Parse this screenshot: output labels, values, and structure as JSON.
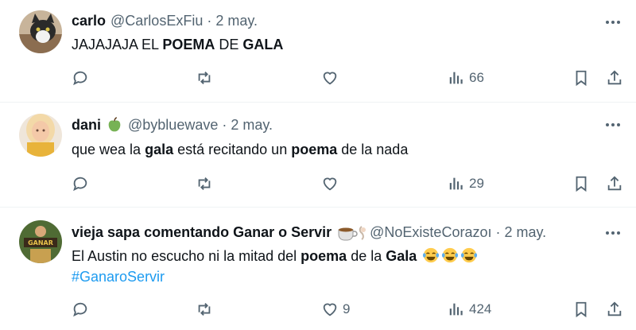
{
  "tweets": [
    {
      "name": "carlo",
      "handle": "@CarlosExFiu",
      "sep": "·",
      "time": "2 may.",
      "body": [
        {
          "t": "JAJAJAJA EL ",
          "b": false
        },
        {
          "t": "POEMA",
          "b": true
        },
        {
          "t": " DE ",
          "b": false
        },
        {
          "t": "GALA",
          "b": true
        }
      ],
      "views": "66",
      "likes": "",
      "avatar_colors": [
        "#b9a58c",
        "#2b2b2b"
      ]
    },
    {
      "name": "dani",
      "badge_icon": "green-apple-icon",
      "handle": "@byblue­wave",
      "sep": "·",
      "time": "2 may.",
      "body": [
        {
          "t": "que wea la ",
          "b": false
        },
        {
          "t": "gala",
          "b": true
        },
        {
          "t": " está recitando un ",
          "b": false
        },
        {
          "t": "poema",
          "b": true
        },
        {
          "t": " de la nada",
          "b": false
        }
      ],
      "views": "29",
      "likes": "",
      "avatar_colors": [
        "#f0c89a",
        "#e8b33a"
      ]
    },
    {
      "name": "vieja sapa comentando Ganar o Servir",
      "badge_icon": "coffee-cup-icon",
      "handle": "@NoExisteCorazoı",
      "sep": "·",
      "time": "2 may.",
      "body": [
        {
          "t": "El Austin no escucho ni la mitad del ",
          "b": false
        },
        {
          "t": "poema",
          "b": true
        },
        {
          "t": " de la ",
          "b": false
        },
        {
          "t": "Gala",
          "b": true
        }
      ],
      "laugh_count": 3,
      "hashtag": "#GanaroServir",
      "views": "424",
      "likes": "9",
      "avatar_colors": [
        "#5a7a3a",
        "#d8b04a"
      ]
    }
  ],
  "icons": {
    "reply": "reply-icon",
    "retweet": "retweet-icon",
    "like": "heart-icon",
    "views": "views-icon",
    "bookmark": "bookmark-icon",
    "share": "share-icon",
    "more": "more-icon",
    "laugh": "face-with-tears-of-joy-icon"
  },
  "colors": {
    "text": "#0f1419",
    "secondary": "#536471",
    "link": "#1d9bf0",
    "divider": "#eff3f4"
  }
}
